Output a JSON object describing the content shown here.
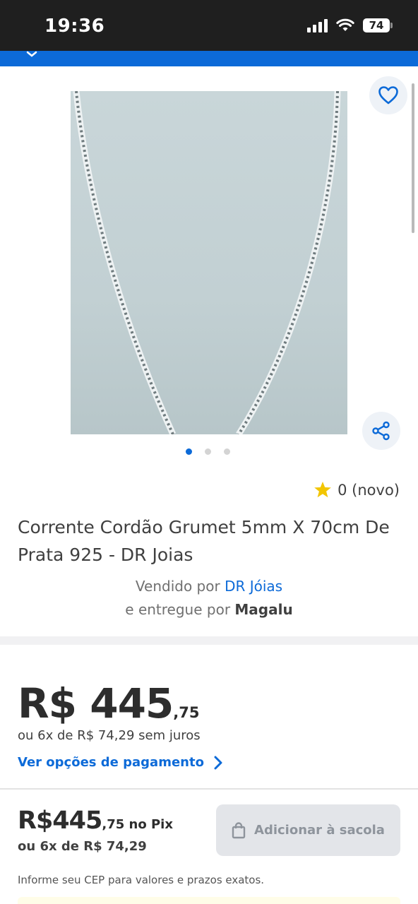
{
  "status_bar": {
    "time": "19:36",
    "battery": "74"
  },
  "product": {
    "title": "Corrente Cordão Grumet 5mm X 70cm De Prata 925 - DR Joias",
    "rating_text": "0 (novo)",
    "image_count": 3,
    "active_image_index": 0
  },
  "seller": {
    "sold_by_prefix": "Vendido por",
    "seller_name": "DR Jóias",
    "delivered_by_prefix": "e entregue por",
    "delivered_by_name": "Magalu"
  },
  "price": {
    "main": "R$ 445",
    "cents": ",75",
    "installments": "ou 6x de R$ 74,29 sem juros",
    "payment_options_link": "Ver opções de pagamento"
  },
  "bottom_bar": {
    "price_main": "R$445",
    "price_cents": ",75",
    "pix_label": " no Pix",
    "installments": "ou 6x de R$ 74,29",
    "add_button_label": "Adicionar à sacola",
    "cep_note": "Informe seu CEP para valores e prazos exatos."
  },
  "colors": {
    "brand_blue": "#0c6ad8",
    "star_yellow": "#f2c500",
    "disabled_button": "#e3e5e9"
  }
}
